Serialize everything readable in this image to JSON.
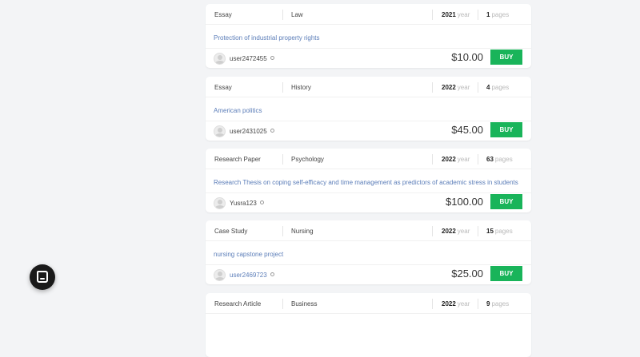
{
  "orders": [
    {
      "type": "Essay",
      "subject": "Law",
      "year": "2021",
      "year_unit": "year",
      "pages": "1",
      "pages_unit": "pages",
      "title": "Protection of industrial property rights",
      "user": "user2472455",
      "price": "$10.00",
      "buy_label": "BUY"
    },
    {
      "type": "Essay",
      "subject": "History",
      "year": "2022",
      "year_unit": "year",
      "pages": "4",
      "pages_unit": "pages",
      "title": "American politics",
      "user": "user2431025",
      "price": "$45.00",
      "buy_label": "BUY"
    },
    {
      "type": "Research Paper",
      "subject": "Psychology",
      "year": "2022",
      "year_unit": "year",
      "pages": "63",
      "pages_unit": "pages",
      "title": "Research Thesis on coping self-efficacy and time management as predictors of academic stress in students",
      "user": "Yusra123",
      "price": "$100.00",
      "buy_label": "BUY"
    },
    {
      "type": "Case Study",
      "subject": "Nursing",
      "year": "2022",
      "year_unit": "year",
      "pages": "15",
      "pages_unit": "pages",
      "title": "nursing capstone project",
      "user": "user2469723",
      "price": "$25.00",
      "buy_label": "BUY"
    },
    {
      "type": "Research Article",
      "subject": "Business",
      "year": "2022",
      "year_unit": "year",
      "pages": "9",
      "pages_unit": "pages"
    }
  ],
  "colors": {
    "accent": "#19b45a",
    "link": "#5b7db8",
    "chat": "#1a1a1a"
  },
  "chat_widget": {
    "icon": "chat-icon"
  }
}
